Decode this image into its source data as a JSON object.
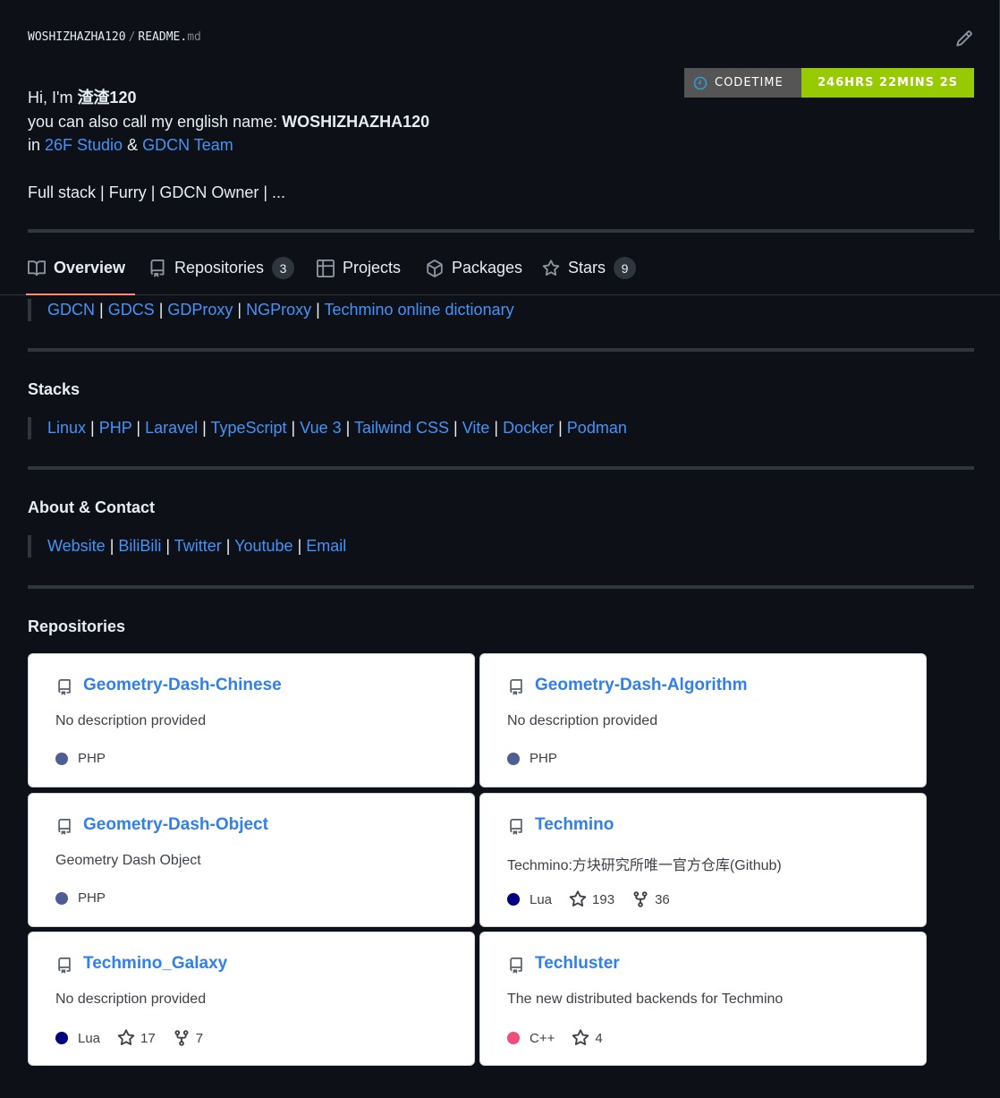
{
  "readme": {
    "owner": "WOSHIZHAZHA120",
    "separator": "/",
    "file_base": "README.",
    "file_ext": "md",
    "badge": {
      "label": "CODETIME",
      "value": "246HRS 22MINS 2S",
      "label_color": "#555555",
      "value_color": "#97ca00"
    },
    "intro": {
      "hi_prefix": "Hi, I'm ",
      "name_cn": "渣渣120",
      "english_prefix": "you can also call my english name: ",
      "english_name": "WOSHIZHAZHA120",
      "in_prefix": "in ",
      "studio": "26F Studio",
      "amp": " & ",
      "team": "GDCN Team",
      "tagline": "Full stack | Furry | GDCN Owner | ..."
    }
  },
  "tabs": [
    {
      "label": "Overview",
      "icon": "book-icon",
      "active": true
    },
    {
      "label": "Repositories",
      "icon": "repo-icon",
      "count": "3"
    },
    {
      "label": "Projects",
      "icon": "table-icon"
    },
    {
      "label": "Packages",
      "icon": "package-icon"
    },
    {
      "label": "Stars",
      "icon": "star-icon",
      "count": "9"
    }
  ],
  "projects": [
    "GDCN",
    "GDCS",
    "GDProxy",
    "NGProxy",
    "Techmino online dictionary"
  ],
  "stacks": {
    "title": "Stacks",
    "items": [
      "Linux",
      "PHP",
      "Laravel",
      "TypeScript",
      "Vue 3",
      "Tailwind CSS",
      "Vite",
      "Docker",
      "Podman"
    ]
  },
  "about": {
    "title": "About & Contact",
    "items": [
      "Website",
      "BiliBili",
      "Twitter",
      "Youtube",
      "Email"
    ]
  },
  "repositories": {
    "title": "Repositories",
    "cards": [
      {
        "name": "Geometry-Dash-Chinese",
        "description": "No description provided",
        "language": "PHP",
        "lang_color": "#4f5d95"
      },
      {
        "name": "Geometry-Dash-Algorithm",
        "description": "No description provided",
        "language": "PHP",
        "lang_color": "#4f5d95"
      },
      {
        "name": "Geometry-Dash-Object",
        "description": "Geometry Dash Object",
        "language": "PHP",
        "lang_color": "#4f5d95"
      },
      {
        "name": "Techmino",
        "description": "Techmino:方块研究所唯一官方仓库(Github)",
        "language": "Lua",
        "lang_color": "#000080",
        "stars": "193",
        "forks": "36"
      },
      {
        "name": "Techmino_Galaxy",
        "description": "No description provided",
        "language": "Lua",
        "lang_color": "#000080",
        "stars": "17",
        "forks": "7"
      },
      {
        "name": "Techluster",
        "description": "The new distributed backends for Techmino",
        "language": "C++",
        "lang_color": "#f34b7d",
        "stars": "4"
      }
    ]
  }
}
